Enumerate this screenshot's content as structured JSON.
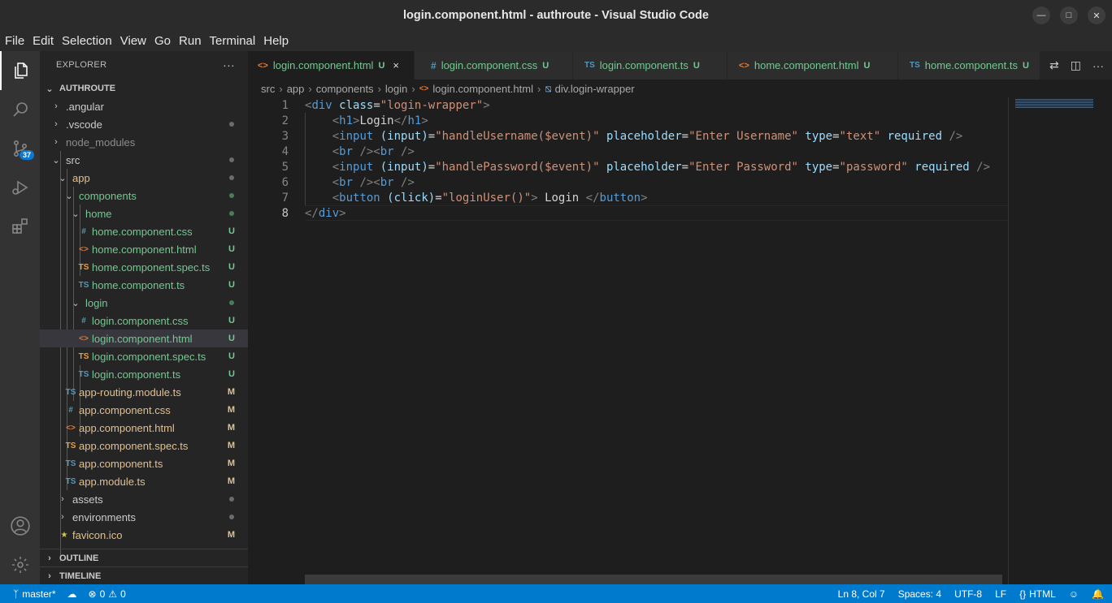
{
  "window": {
    "title": "login.component.html - authroute - Visual Studio Code"
  },
  "menu": [
    "File",
    "Edit",
    "Selection",
    "View",
    "Go",
    "Run",
    "Terminal",
    "Help"
  ],
  "activity": {
    "source_control_badge": "37"
  },
  "explorer": {
    "header": "EXPLORER",
    "more": "···",
    "root": "AUTHROUTE",
    "items": [
      {
        "label": ".angular",
        "status": "",
        "color": "#cccccc"
      },
      {
        "label": ".vscode",
        "status": "",
        "color": "#cccccc"
      },
      {
        "label": "node_modules",
        "status": "",
        "color": "#8c8c8c"
      },
      {
        "label": "src",
        "status": "",
        "color": "#cccccc"
      },
      {
        "label": "app",
        "status": "",
        "color": "#e2c08d"
      },
      {
        "label": "components",
        "status": "",
        "color": "#73c991"
      },
      {
        "label": "home",
        "status": "",
        "color": "#73c991"
      },
      {
        "label": "home.component.css",
        "status": "U",
        "color": "#73c991"
      },
      {
        "label": "home.component.html",
        "status": "U",
        "color": "#73c991"
      },
      {
        "label": "home.component.spec.ts",
        "status": "U",
        "color": "#73c991"
      },
      {
        "label": "home.component.ts",
        "status": "U",
        "color": "#73c991"
      },
      {
        "label": "login",
        "status": "",
        "color": "#73c991"
      },
      {
        "label": "login.component.css",
        "status": "U",
        "color": "#73c991"
      },
      {
        "label": "login.component.html",
        "status": "U",
        "color": "#73c991"
      },
      {
        "label": "login.component.spec.ts",
        "status": "U",
        "color": "#73c991"
      },
      {
        "label": "login.component.ts",
        "status": "U",
        "color": "#73c991"
      },
      {
        "label": "app-routing.module.ts",
        "status": "M",
        "color": "#e2c08d"
      },
      {
        "label": "app.component.css",
        "status": "M",
        "color": "#e2c08d"
      },
      {
        "label": "app.component.html",
        "status": "M",
        "color": "#e2c08d"
      },
      {
        "label": "app.component.spec.ts",
        "status": "M",
        "color": "#e2c08d"
      },
      {
        "label": "app.component.ts",
        "status": "M",
        "color": "#e2c08d"
      },
      {
        "label": "app.module.ts",
        "status": "M",
        "color": "#e2c08d"
      },
      {
        "label": "assets",
        "status": "",
        "color": "#cccccc"
      },
      {
        "label": "environments",
        "status": "",
        "color": "#cccccc"
      },
      {
        "label": "favicon.ico",
        "status": "M",
        "color": "#e2c08d"
      }
    ],
    "sections": [
      "OUTLINE",
      "TIMELINE"
    ]
  },
  "tabs": [
    {
      "label": "login.component.html",
      "status": "U",
      "icon": "<>"
    },
    {
      "label": "login.component.css",
      "status": "U",
      "icon": "#"
    },
    {
      "label": "login.component.ts",
      "status": "U",
      "icon": "TS"
    },
    {
      "label": "home.component.html",
      "status": "U",
      "icon": "<>"
    },
    {
      "label": "home.component.ts",
      "status": "U",
      "icon": "TS"
    }
  ],
  "tab_close": "×",
  "breadcrumb": [
    "src",
    "app",
    "components",
    "login",
    "login.component.html",
    "div.login-wrapper"
  ],
  "editor": {
    "line_numbers": [
      "1",
      "2",
      "3",
      "4",
      "5",
      "6",
      "7",
      "8"
    ],
    "lines": [
      "<div class=\"login-wrapper\">",
      "    <h1>Login</h1>",
      "    <input (input)=\"handleUsername($event)\" placeholder=\"Enter Username\" type=\"text\" required />",
      "    <br /><br />",
      "    <input (input)=\"handlePassword($event)\" placeholder=\"Enter Password\" type=\"password\" required />",
      "    <br /><br />",
      "    <button (click)=\"loginUser()\"> Login </button>",
      "</div>"
    ]
  },
  "status": {
    "branch": "master*",
    "errors": "0",
    "warnings": "0",
    "position": "Ln 8, Col 7",
    "spaces": "Spaces: 4",
    "encoding": "UTF-8",
    "eol": "LF",
    "language": "HTML"
  }
}
